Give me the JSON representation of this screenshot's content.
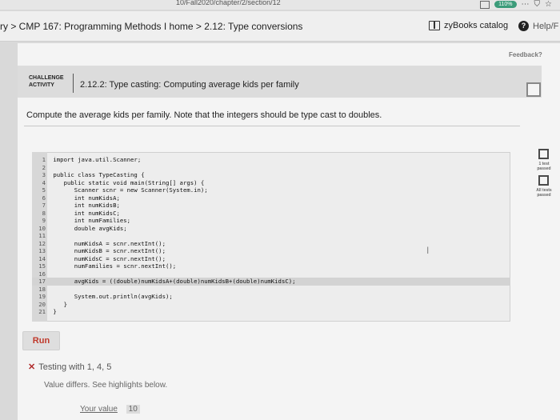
{
  "browser": {
    "url_fragment": "10/Fall2020/chapter/2/section/12",
    "zoom": "110%"
  },
  "nav": {
    "breadcrumb": "ry > CMP 167: Programming Methods I home > 2.12: Type conversions",
    "catalog_label": "zyBooks catalog",
    "help_label": "Help/F"
  },
  "feedback_label": "Feedback?",
  "challenge": {
    "tag_line1": "CHALLENGE",
    "tag_line2": "ACTIVITY",
    "title": "2.12.2: Type casting: Computing average kids per family"
  },
  "prompt": "Compute the average kids per family. Note that the integers should be type cast to doubles.",
  "side_progress": [
    {
      "label": "1 test passed"
    },
    {
      "label": "All tests passed"
    }
  ],
  "code": [
    {
      "n": "1",
      "text": " import java.util.Scanner;"
    },
    {
      "n": "2",
      "text": ""
    },
    {
      "n": "3",
      "text": " public class TypeCasting {"
    },
    {
      "n": "4",
      "text": "    public static void main(String[] args) {"
    },
    {
      "n": "5",
      "text": "       Scanner scnr = new Scanner(System.in);"
    },
    {
      "n": "6",
      "text": "       int numKidsA;"
    },
    {
      "n": "7",
      "text": "       int numKidsB;"
    },
    {
      "n": "8",
      "text": "       int numKidsC;"
    },
    {
      "n": "9",
      "text": "       int numFamilies;"
    },
    {
      "n": "10",
      "text": "       double avgKids;"
    },
    {
      "n": "11",
      "text": ""
    },
    {
      "n": "12",
      "text": "       numKidsA = scnr.nextInt();"
    },
    {
      "n": "13",
      "text": "       numKidsB = scnr.nextInt();"
    },
    {
      "n": "14",
      "text": "       numKidsC = scnr.nextInt();"
    },
    {
      "n": "15",
      "text": "       numFamilies = scnr.nextInt();"
    },
    {
      "n": "16",
      "text": ""
    },
    {
      "n": "17",
      "text": "       avgKids = ((double)numKidsA+(double)numKidsB+(double)numKidsC);"
    },
    {
      "n": "18",
      "text": ""
    },
    {
      "n": "19",
      "text": "       System.out.println(avgKids);"
    },
    {
      "n": "20",
      "text": "    }"
    },
    {
      "n": "21",
      "text": " }"
    }
  ],
  "run_label": "Run",
  "result": {
    "heading": "Testing with 1, 4, 5",
    "message": "Value differs. See highlights below.",
    "your_value_label": "Your value",
    "your_value": "10"
  }
}
